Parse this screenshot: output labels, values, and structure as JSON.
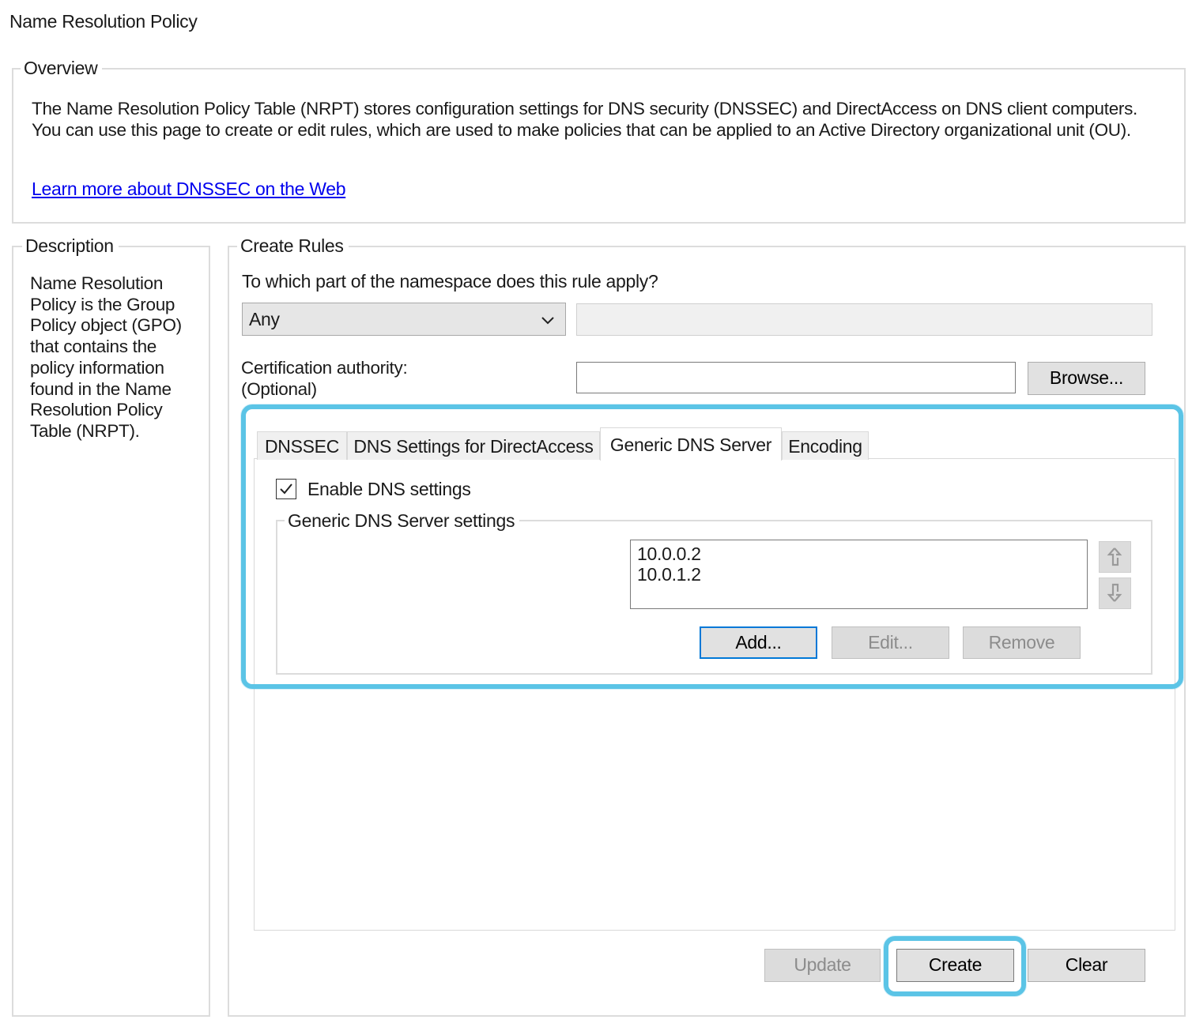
{
  "page_title": "Name Resolution Policy",
  "overview": {
    "legend": "Overview",
    "lines": [
      "The Name Resolution Policy Table (NRPT) stores configuration settings for DNS security (DNSSEC) and DirectAccess on DNS client computers.",
      "You can use this page to create or edit rules, which are used to make policies that can be applied to an Active Directory organizational unit (OU)."
    ],
    "link": "Learn more about DNSSEC on the Web"
  },
  "description": {
    "legend": "Description",
    "lines": [
      "Name Resolution",
      "Policy is the Group",
      "Policy object (GPO)",
      "that contains the",
      "policy information",
      "found in the Name",
      "Resolution Policy",
      "Table (NRPT)."
    ]
  },
  "create_rules": {
    "legend": "Create Rules",
    "question": "To which part of the namespace does this rule apply?",
    "namespace_select": "Any",
    "cert_label_lines": [
      "Certification authority:",
      "(Optional)"
    ],
    "browse_label": "Browse...",
    "tabs": [
      "DNSSEC",
      "DNS Settings for DirectAccess",
      "Generic DNS Server",
      "Encoding"
    ],
    "active_tab": "Generic DNS Server",
    "enable_label": "Enable DNS settings",
    "enable_checked": true,
    "settings_legend": "Generic DNS Server settings",
    "dns_servers": [
      "10.0.0.2",
      "10.0.1.2"
    ],
    "add_label": "Add...",
    "edit_label": "Edit...",
    "remove_label": "Remove"
  },
  "footer": {
    "update_label": "Update",
    "create_label": "Create",
    "clear_label": "Clear"
  },
  "colors": {
    "highlight": "#5bc4e6",
    "link": "#0000ee",
    "focus_border": "#0078d7"
  },
  "icons": [
    "chevron-down-icon",
    "checkmark-icon",
    "move-up-icon",
    "move-down-icon"
  ]
}
